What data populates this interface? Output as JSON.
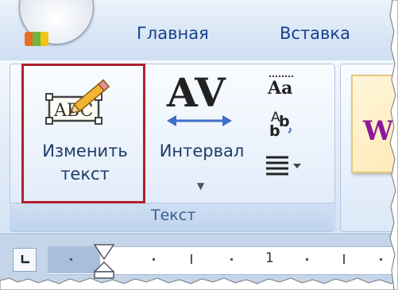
{
  "tabs": {
    "home": "Главная",
    "insert": "Вставка"
  },
  "text_group": {
    "change_text_label_line1": "Изменить",
    "change_text_label_line2": "текст",
    "interval_label": "Интервал",
    "group_label": "Текст"
  },
  "ruler": {
    "number": "1"
  },
  "icons": {
    "office_button": "office-logo-icon",
    "change_text": "abc-pencil-icon",
    "interval": "av-spacing-icon",
    "same_height": "aa-equal-height-icon",
    "vertical_text": "ab-vertical-text-icon",
    "align": "text-align-icon",
    "tab_stop": "tab-stop-icon",
    "indent_marker": "indent-hourglass-icon"
  },
  "colors": {
    "highlight_border": "#b0202e",
    "tab_text": "#15428b",
    "group_label_text": "#3b5f8f"
  }
}
